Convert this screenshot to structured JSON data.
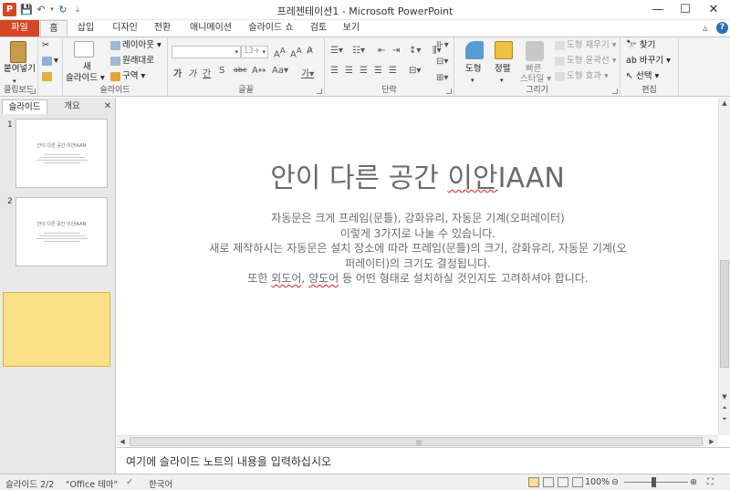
{
  "window": {
    "title": "프레젠테이션1 - Microsoft PowerPoint",
    "app_icon": "P",
    "controls": {
      "minimize": "—",
      "maximize": "☐",
      "close": "✕"
    }
  },
  "tabs": [
    {
      "label": "파일"
    },
    {
      "label": "홈"
    },
    {
      "label": "삽입"
    },
    {
      "label": "디자인"
    },
    {
      "label": "전환"
    },
    {
      "label": "애니메이션"
    },
    {
      "label": "슬라이드 쇼"
    },
    {
      "label": "검토"
    },
    {
      "label": "보기"
    }
  ],
  "ribbon": {
    "clipboard": {
      "paste": "붙여넣기",
      "label": "클립보드"
    },
    "slides": {
      "new_slide": "새",
      "new_slide2": "슬라이드 ▾",
      "layout": "레이아웃 ▾",
      "reset": "원래대로",
      "section": "구역 ▾",
      "label": "슬라이드"
    },
    "font": {
      "size": "13+",
      "label": "글꼴"
    },
    "paragraph": {
      "label": "단락"
    },
    "drawing": {
      "shapes": "도형",
      "arrange": "정렬",
      "quick_styles": "빠른",
      "quick_styles2": "스타일 ▾",
      "fill": "도형 채우기 ▾",
      "outline": "도형 윤곽선 ▾",
      "effects": "도형 효과 ▾",
      "label": "그리기"
    },
    "editing": {
      "find": "찾기",
      "replace": "바꾸기 ▾",
      "select": "선택 ▾",
      "label": "편집"
    }
  },
  "left_pane": {
    "tab_slides": "슬라이드",
    "tab_outline": "개요",
    "close": "✕",
    "thumbs": [
      {
        "num": "1",
        "title": "안이 다른 공간 이안IAAN"
      },
      {
        "num": "2",
        "title": "안이 다른 공간 이안IAAN"
      }
    ]
  },
  "slide": {
    "title_pre": "안이 다른 공간 ",
    "title_squig": "이안",
    "title_post": "IAAN",
    "lines": [
      "자동문은 크게 프레임(문틀), 강화유리, 자동문 기계(오퍼레이터)",
      "이렇게 3가지로 나눌 수 있습니다.",
      "새로 제작하시는 자동문은 설치 장소에 따라 프레임(문틀)의 크기, 강화유리, 자동문 기계(오",
      "퍼레이터)의 크기도 결정됩니다."
    ],
    "last_pre": "또한 ",
    "last_squig1": "외도어",
    "last_mid": ", ",
    "last_squig2": "양도어",
    "last_post": " 등 어떤 형태로 설치하실 것인지도 고려하셔야 합니다."
  },
  "notes": {
    "placeholder": "여기에 슬라이드 노트의 내용을 입력하십시오"
  },
  "status": {
    "slide": "슬라이드 2/2",
    "theme": "\"Office 테마\"",
    "language": "한국어",
    "zoom": "100%"
  },
  "colors": {
    "file_tab": "#d24726",
    "selected_thumb": "#fbe08a",
    "title_text": "#6b6b6b"
  }
}
